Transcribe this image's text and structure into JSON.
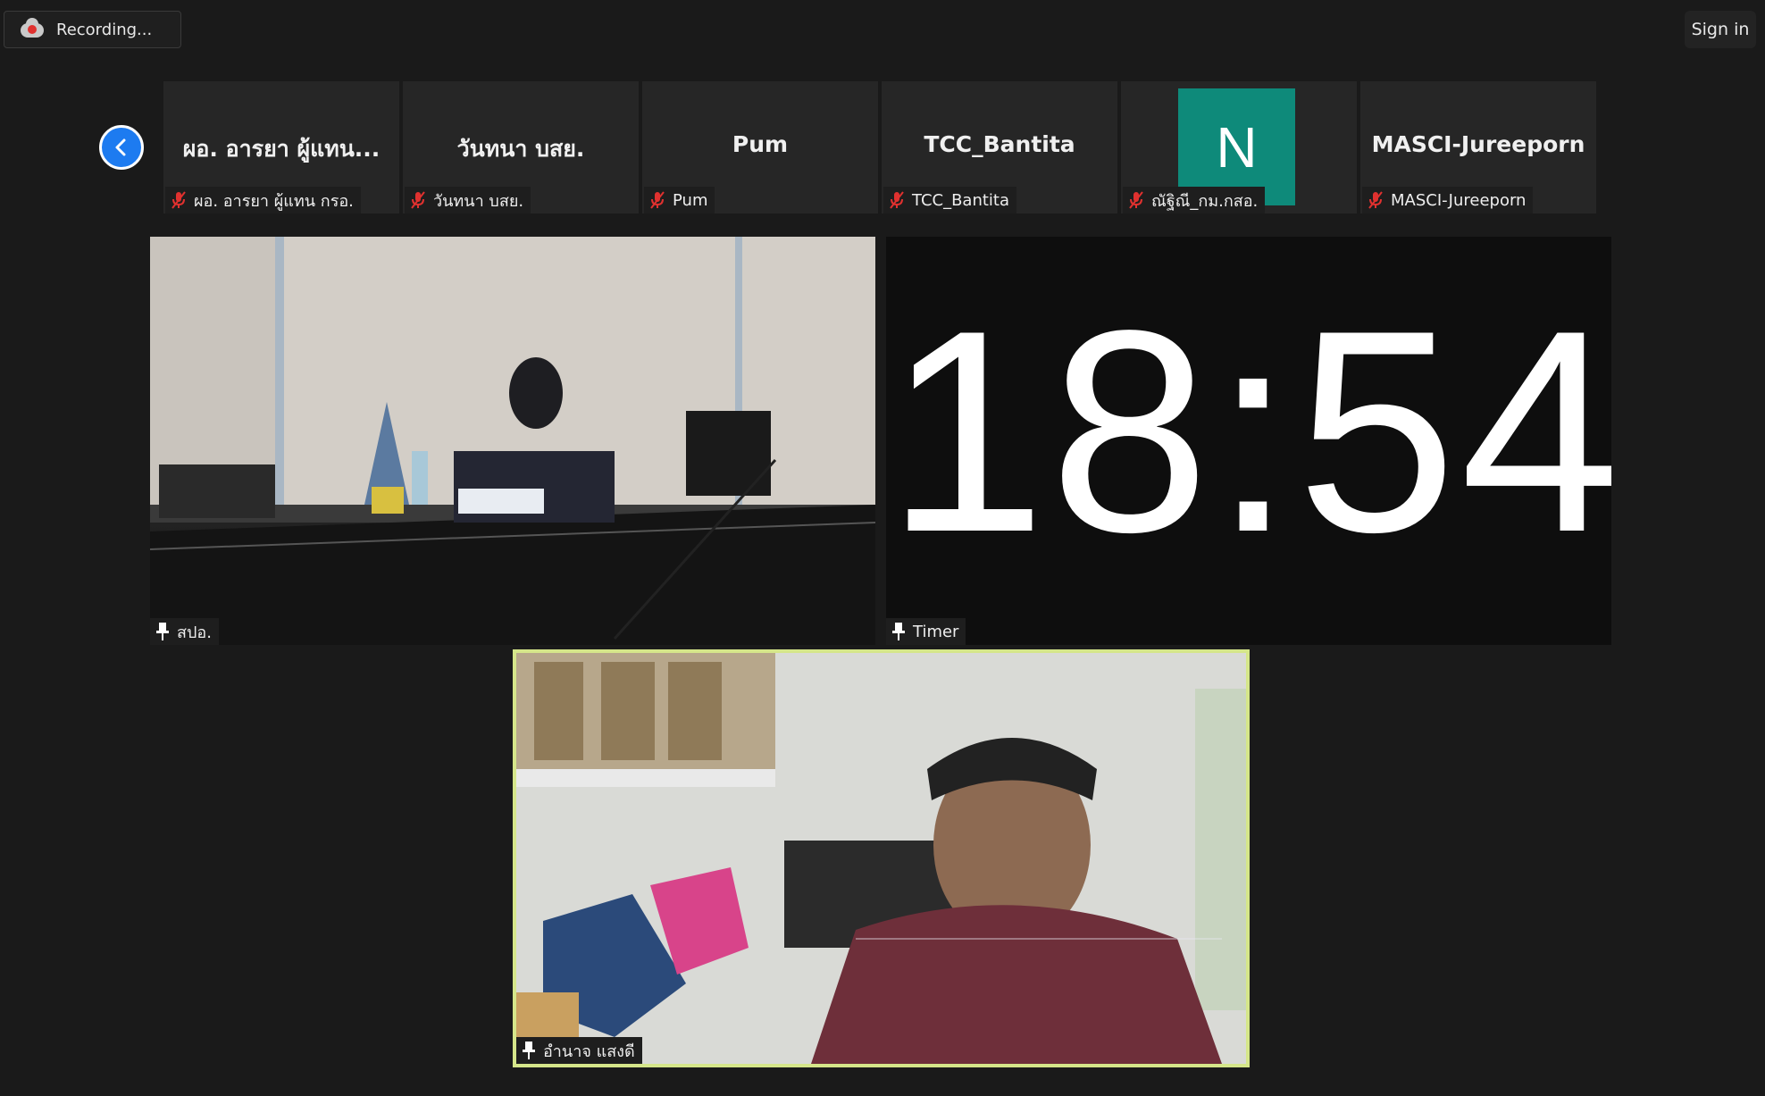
{
  "topbar": {
    "recording_label": "Recording...",
    "signin_label": "Sign in"
  },
  "strip": {
    "tiles": [
      {
        "display_name": "ผอ. อารยา ผู้แทน...",
        "tag_name": "ผอ. อารยา ผู้แทน กรอ.",
        "muted": true
      },
      {
        "display_name": "วันทนา บสย.",
        "tag_name": "วันทนา บสย.",
        "muted": true
      },
      {
        "display_name": "Pum",
        "tag_name": "Pum",
        "muted": true
      },
      {
        "display_name": "TCC_Bantita",
        "tag_name": "TCC_Bantita",
        "muted": true
      },
      {
        "avatar_letter": "N",
        "tag_name": "ณัฐิณี_กม.กสอ.",
        "muted": true
      },
      {
        "display_name": "MASCI-Jureeporn",
        "tag_name": "MASCI-Jureeporn",
        "muted": true
      }
    ]
  },
  "videos": {
    "main_left": {
      "name": "สปอ."
    },
    "timer": {
      "name": "Timer",
      "digits": "18:54"
    },
    "active_speaker": {
      "name": "อำนาจ แสงดี"
    }
  },
  "colors": {
    "background": "#1a1a1a",
    "accent_blue": "#1d7bf0",
    "mute_red": "#e0312f",
    "active_border": "#d5e68a",
    "avatar_teal": "#0e8a7a"
  }
}
